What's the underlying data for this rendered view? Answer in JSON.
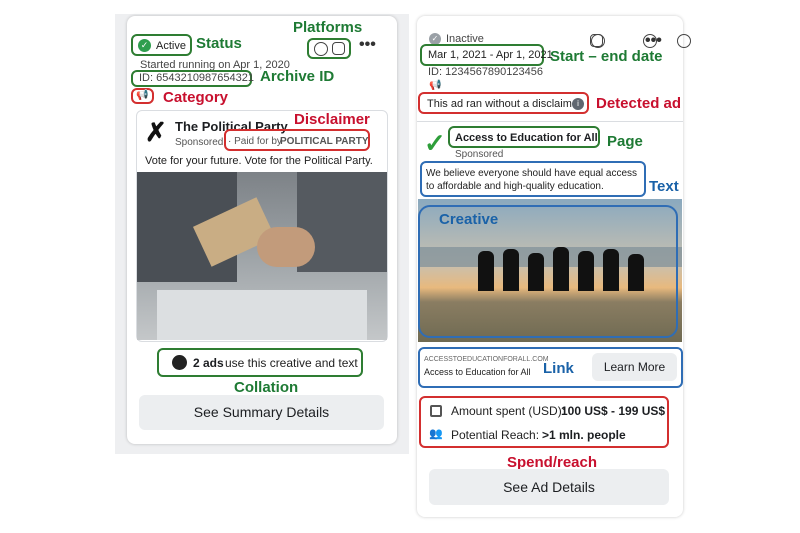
{
  "left_card": {
    "status": "Active",
    "started": "Started running on Apr 1, 2020",
    "archive_id": "ID: 6543210987654321",
    "advertiser": "The Political Party",
    "sponsored": "Sponsored",
    "paid_for_prefix": "· Paid for by",
    "paid_for_name": "POLITICAL PARTY",
    "ad_text": "Vote for your future. Vote for the Political Party.",
    "collation_count": "2 ads",
    "collation_suffix": "use this creative and text",
    "button": "See Summary Details"
  },
  "right_card": {
    "status": "Inactive",
    "date_range": "Mar 1, 2021 - Apr 1, 2021",
    "id": "ID: 1234567890123456",
    "disclaimer_notice": "This ad ran without a disclaimer.",
    "page_name": "Access to Education for All",
    "sponsored": "Sponsored",
    "ad_text": "We believe everyone should have equal access to affordable and high-quality education.",
    "link_url": "ACCESSTOEDUCATIONFORALL.COM",
    "link_title": "Access to Education for All",
    "cta": "Learn More",
    "amount_label": "Amount spent (USD):",
    "amount_value": "100 US$ - 199 US$",
    "reach_label": "Potential Reach:",
    "reach_value": ">1 mln. people",
    "button": "See Ad Details"
  },
  "annotations": {
    "status": "Status",
    "platforms": "Platforms",
    "archive_id": "Archive ID",
    "category": "Category",
    "disclaimer": "Disclaimer",
    "collation": "Collation",
    "start_end": "Start – end date",
    "detected_ad": "Detected ad",
    "page": "Page",
    "text": "Text",
    "creative": "Creative",
    "link": "Link",
    "spend_reach": "Spend/reach"
  },
  "colors": {
    "annotation_green": "#1e7a34",
    "annotation_red": "#c8102e",
    "annotation_blue": "#1a62a8"
  }
}
